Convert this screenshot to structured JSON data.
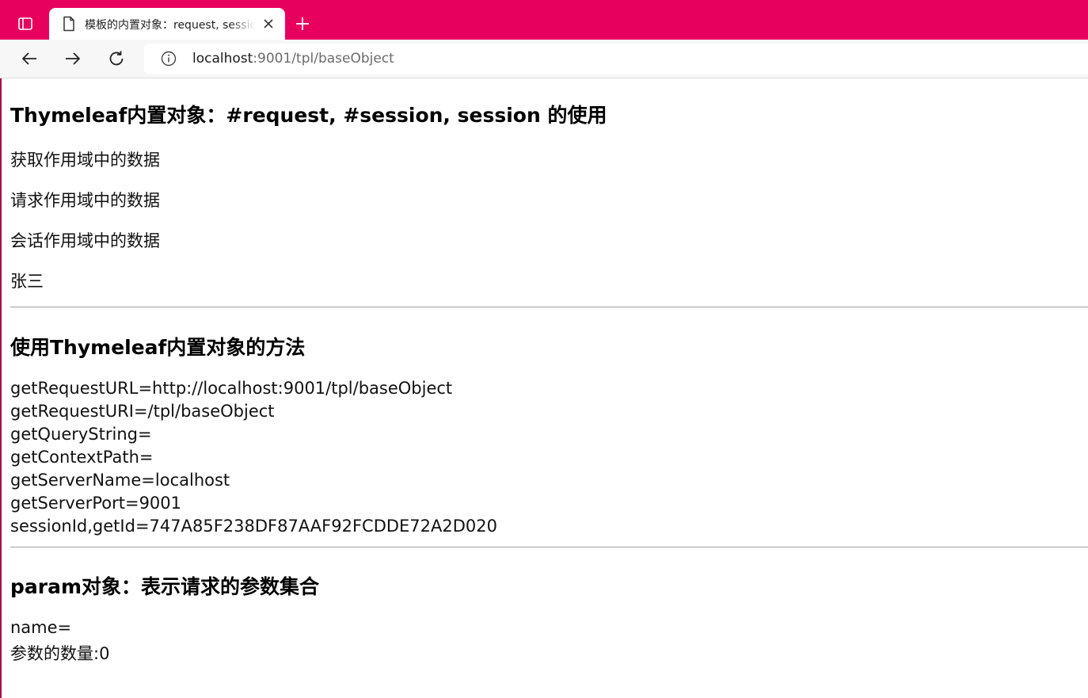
{
  "browser": {
    "tab": {
      "title": "模板的内置对象：request, session"
    },
    "address_bar": {
      "host": "localhost",
      "rest": ":9001/tpl/baseObject"
    },
    "accent_color": "#e8005e"
  },
  "page": {
    "section1": {
      "heading": "Thymeleaf内置对象：#request, #session, session 的使用",
      "paragraphs": [
        "获取作用域中的数据",
        "请求作用域中的数据",
        "会话作用域中的数据",
        "张三"
      ]
    },
    "section2": {
      "heading": "使用Thymeleaf内置对象的方法",
      "lines": [
        "getRequestURL=http://localhost:9001/tpl/baseObject",
        "getRequestURI=/tpl/baseObject",
        "getQueryString=",
        "getContextPath=",
        "getServerName=localhost",
        "getServerPort=9001",
        "sessionId,getId=747A85F238DF87AAF92FCDDE72A2D020"
      ]
    },
    "section3": {
      "heading": "param对象：表示请求的参数集合",
      "lines": [
        "name=",
        "参数的数量:0"
      ]
    }
  }
}
